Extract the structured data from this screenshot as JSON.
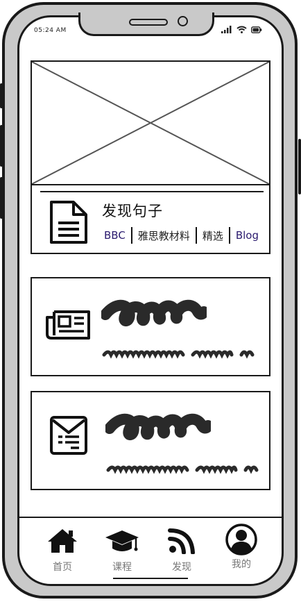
{
  "status_bar": {
    "time": "05:24 AM"
  },
  "featured": {
    "title": "发现句子",
    "tags": [
      "BBC",
      "雅思教材料",
      "精选",
      "Blog"
    ]
  },
  "tabbar": {
    "items": [
      {
        "label": "首页",
        "icon": "home-icon"
      },
      {
        "label": "课程",
        "icon": "graduation-cap-icon"
      },
      {
        "label": "发现",
        "icon": "rss-icon"
      },
      {
        "label": "我的",
        "icon": "user-circle-icon"
      }
    ],
    "active_index": 1
  },
  "colors": {
    "tag_link": "#2a1a6e",
    "outline": "#1a1a1a",
    "tab_label": "#777777"
  }
}
